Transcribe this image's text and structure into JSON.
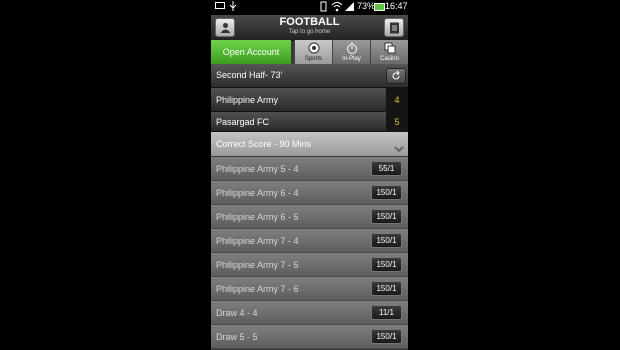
{
  "status_bar": {
    "battery": "73%",
    "time": "16:47"
  },
  "header": {
    "title": "FOOTBALL",
    "subtitle": "Tap to go home"
  },
  "nav": {
    "open_account": "Open Account",
    "tabs": [
      {
        "label": "Sports",
        "icon": "soccer-ball-icon",
        "active": true
      },
      {
        "label": "In-Play",
        "icon": "stopwatch-icon",
        "active": false
      },
      {
        "label": "Casino",
        "icon": "dice-icon",
        "active": false
      }
    ]
  },
  "match": {
    "status": "Second Half- 73'",
    "teams": [
      {
        "name": "Philippine Army",
        "score": "4"
      },
      {
        "name": "Pasargad FC",
        "score": "5"
      }
    ]
  },
  "market": {
    "title": "Correct Score - 90 Mins",
    "selections": [
      {
        "name": "Philippine Army 5 - 4",
        "odds": "55/1"
      },
      {
        "name": "Philippine Army 6 - 4",
        "odds": "150/1"
      },
      {
        "name": "Philippine Army 6 - 5",
        "odds": "150/1"
      },
      {
        "name": "Philippine Army 7 - 4",
        "odds": "150/1"
      },
      {
        "name": "Philippine Army 7 - 5",
        "odds": "150/1"
      },
      {
        "name": "Philippine Army 7 - 6",
        "odds": "150/1"
      },
      {
        "name": "Draw 4 - 4",
        "odds": "11/1"
      },
      {
        "name": "Draw 5 - 5",
        "odds": "150/1"
      }
    ]
  },
  "colors": {
    "accent_green": "#4cbb26",
    "score_yellow": "#f0c020"
  }
}
